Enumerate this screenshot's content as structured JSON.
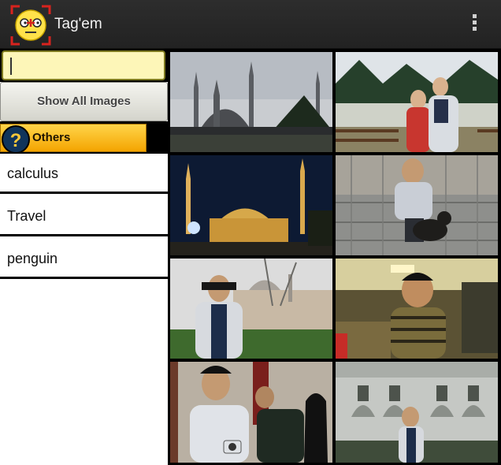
{
  "app": {
    "title": "Tag'em",
    "logo_icon": "tagem-face-logo-icon",
    "menu_icon": "overflow-menu-icon"
  },
  "search": {
    "value": "",
    "placeholder": ""
  },
  "buttons": {
    "show_all": "Show All Images"
  },
  "others": {
    "label": "Others",
    "icon": "question-icon"
  },
  "tags": [
    {
      "label": "calculus"
    },
    {
      "label": "Travel"
    },
    {
      "label": "penguin"
    }
  ],
  "photos": [
    {
      "name": "photo-mosque-day"
    },
    {
      "name": "photo-couple-snow"
    },
    {
      "name": "photo-mosque-night"
    },
    {
      "name": "photo-man-with-dog"
    },
    {
      "name": "photo-man-palace"
    },
    {
      "name": "photo-man-cafe"
    },
    {
      "name": "photo-man-camera"
    },
    {
      "name": "photo-man-arcade"
    }
  ],
  "colors": {
    "accent": "#f4a400",
    "search_bg": "#fdf6b8",
    "logo_red": "#d8231e"
  }
}
